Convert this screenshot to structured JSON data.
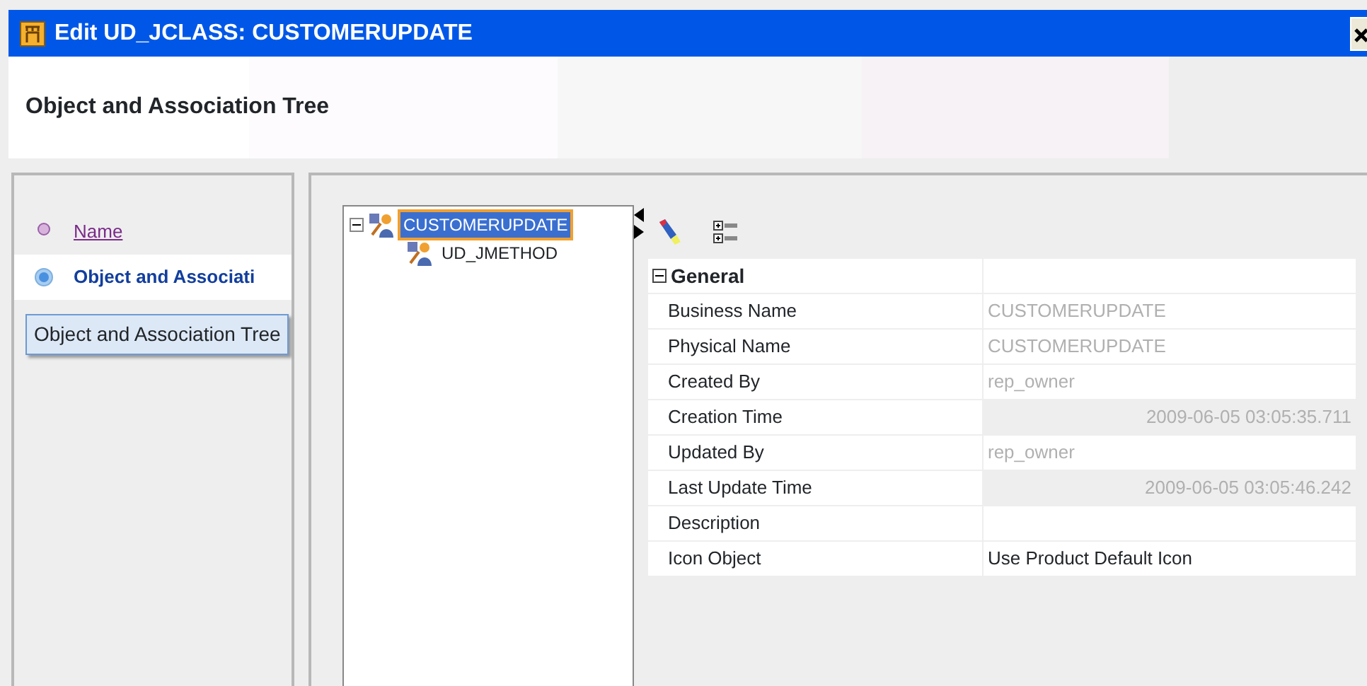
{
  "window": {
    "title": "Edit UD_JCLASS: CUSTOMERUPDATE"
  },
  "header": {
    "title": "Object and Association Tree"
  },
  "steps": [
    {
      "label": "Name",
      "selected": false
    },
    {
      "label": "Object and Associati",
      "selected": true
    }
  ],
  "tooltip": "Object and Association Tree",
  "tree": [
    {
      "label": "CUSTOMERUPDATE",
      "selected": true,
      "expanded": true,
      "children": [
        {
          "label": "UD_JMETHOD",
          "selected": false
        }
      ]
    }
  ],
  "properties": {
    "section": {
      "label": "General",
      "expanded": true
    },
    "rows": [
      {
        "name": "Business Name",
        "value": "CUSTOMERUPDATE",
        "kind": "text",
        "readonly": true
      },
      {
        "name": "Physical Name",
        "value": "CUSTOMERUPDATE",
        "kind": "text",
        "readonly": true
      },
      {
        "name": "Created By",
        "value": "rep_owner",
        "kind": "text",
        "readonly": true
      },
      {
        "name": "Creation Time",
        "value": "2009-06-05 03:05:35.711",
        "kind": "timestamp",
        "readonly": true
      },
      {
        "name": "Updated By",
        "value": "rep_owner",
        "kind": "text",
        "readonly": true
      },
      {
        "name": "Last Update Time",
        "value": "2009-06-05 03:05:46.242",
        "kind": "timestamp",
        "readonly": true
      },
      {
        "name": "Description",
        "kind": "text",
        "readonly": false
      },
      {
        "name": "Icon Object",
        "value": "Use Product Default Icon",
        "kind": "text",
        "readonly": false
      }
    ]
  }
}
